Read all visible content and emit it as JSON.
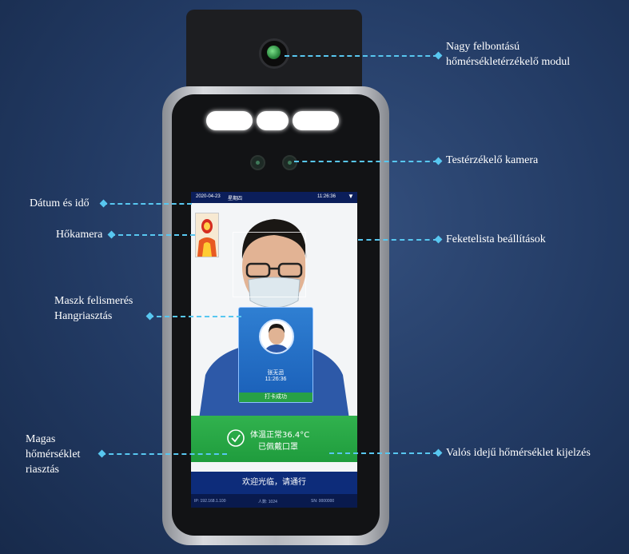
{
  "labels": {
    "sensor_module": [
      "Nagy felbontású",
      "hőmérsékletérzékelő modul"
    ],
    "body_camera": "Testérzékelő kamera",
    "datetime": "Dátum és idő",
    "thermal_camera": "Hőkamera",
    "blacklist": "Feketelista beállítások",
    "mask_voice": [
      "Maszk felismerés",
      "Hangriasztás"
    ],
    "high_temp_alarm": [
      "Magas",
      "hőmérséklet",
      "riasztás"
    ],
    "realtime_temp": "Valós idejű hőmérséklet kijelzés"
  },
  "screen": {
    "topbar_date": "2020-04-23",
    "topbar_day": "星期四",
    "topbar_time": "11:26:36",
    "card_name": "张无忌",
    "card_time": "11:26:36",
    "card_status": "打卡成功",
    "temp_line": "体温正常36.4°C",
    "mask_line": "已佩戴口罩",
    "welcome": "欢迎光临，请通行",
    "info_left": "IP: 192.168.1.100",
    "info_mid": "人数: 1024",
    "info_right": "SN: 0000000"
  },
  "colors": {
    "background": "#223a63",
    "callout_line": "#58c7f0",
    "screen_topbar": "#0b1e5a",
    "status_band": "#31b24e",
    "welcome_bar": "#0d2c7a"
  }
}
